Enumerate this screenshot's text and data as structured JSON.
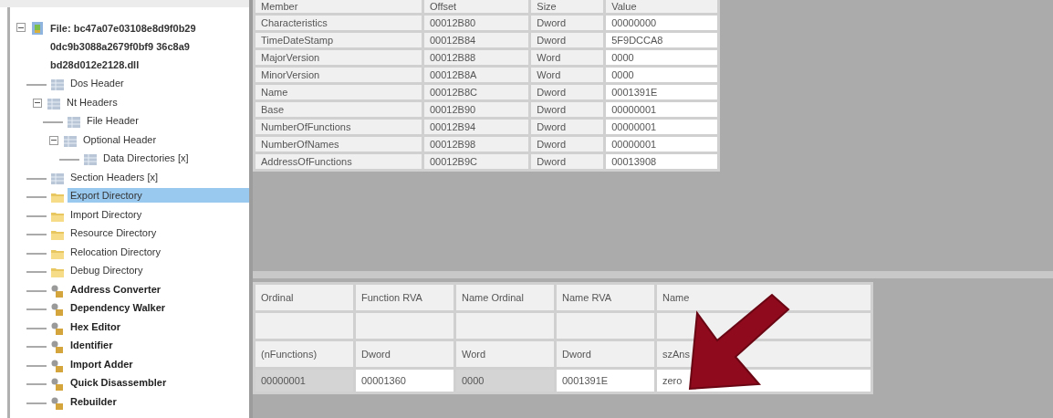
{
  "tree": [
    {
      "kind": "file",
      "label": [
        "File: bc47a07e03108e8d9f0b29",
        "0dc9b3088a2679f0bf9 36c8a9",
        "bd28d012e2128.dll"
      ],
      "expanded": true,
      "selected": false,
      "children": [
        {
          "kind": "header",
          "label": [
            "Dos Header"
          ],
          "selected": false
        },
        {
          "kind": "header",
          "label": [
            "Nt Headers"
          ],
          "expanded": true,
          "selected": false,
          "children": [
            {
              "kind": "header",
              "label": [
                "File Header"
              ],
              "selected": false
            },
            {
              "kind": "header",
              "label": [
                "Optional Header"
              ],
              "expanded": true,
              "selected": false,
              "children": [
                {
                  "kind": "header",
                  "label": [
                    "Data Directories [x]"
                  ],
                  "selected": false
                }
              ]
            }
          ]
        },
        {
          "kind": "header",
          "label": [
            "Section Headers [x]"
          ],
          "selected": false
        },
        {
          "kind": "folder",
          "label": [
            "Export Directory"
          ],
          "selected": true
        },
        {
          "kind": "folder",
          "label": [
            "Import Directory"
          ],
          "selected": false
        },
        {
          "kind": "folder",
          "label": [
            "Resource Directory"
          ],
          "selected": false
        },
        {
          "kind": "folder",
          "label": [
            "Relocation Directory"
          ],
          "selected": false
        },
        {
          "kind": "folder",
          "label": [
            "Debug Directory"
          ],
          "selected": false
        },
        {
          "kind": "tool",
          "label": [
            "Address Converter"
          ],
          "selected": false
        },
        {
          "kind": "tool",
          "label": [
            "Dependency Walker"
          ],
          "selected": false
        },
        {
          "kind": "tool",
          "label": [
            "Hex Editor"
          ],
          "selected": false
        },
        {
          "kind": "tool",
          "label": [
            "Identifier"
          ],
          "selected": false
        },
        {
          "kind": "tool",
          "label": [
            "Import Adder"
          ],
          "selected": false
        },
        {
          "kind": "tool",
          "label": [
            "Quick Disassembler"
          ],
          "selected": false
        },
        {
          "kind": "tool",
          "label": [
            "Rebuilder"
          ],
          "selected": false
        }
      ]
    }
  ],
  "export_table": {
    "columns": [
      "Member",
      "Offset",
      "Size",
      "Value"
    ],
    "rows": [
      [
        "Characteristics",
        "00012B80",
        "Dword",
        "00000000"
      ],
      [
        "TimeDateStamp",
        "00012B84",
        "Dword",
        "5F9DCCA8"
      ],
      [
        "MajorVersion",
        "00012B88",
        "Word",
        "0000"
      ],
      [
        "MinorVersion",
        "00012B8A",
        "Word",
        "0000"
      ],
      [
        "Name",
        "00012B8C",
        "Dword",
        "0001391E"
      ],
      [
        "Base",
        "00012B90",
        "Dword",
        "00000001"
      ],
      [
        "NumberOfFunctions",
        "00012B94",
        "Dword",
        "00000001"
      ],
      [
        "NumberOfNames",
        "00012B98",
        "Dword",
        "00000001"
      ],
      [
        "AddressOfFunctions",
        "00012B9C",
        "Dword",
        "00013908"
      ]
    ]
  },
  "functions_table": {
    "columns": [
      "Ordinal",
      "Function RVA",
      "Name Ordinal",
      "Name RVA",
      "Name"
    ],
    "types": [
      "(nFunctions)",
      "Dword",
      "Word",
      "Dword",
      "szAns"
    ],
    "rows": [
      [
        "00000001",
        "00001360",
        "0000",
        "0001391E",
        "zero"
      ]
    ]
  }
}
